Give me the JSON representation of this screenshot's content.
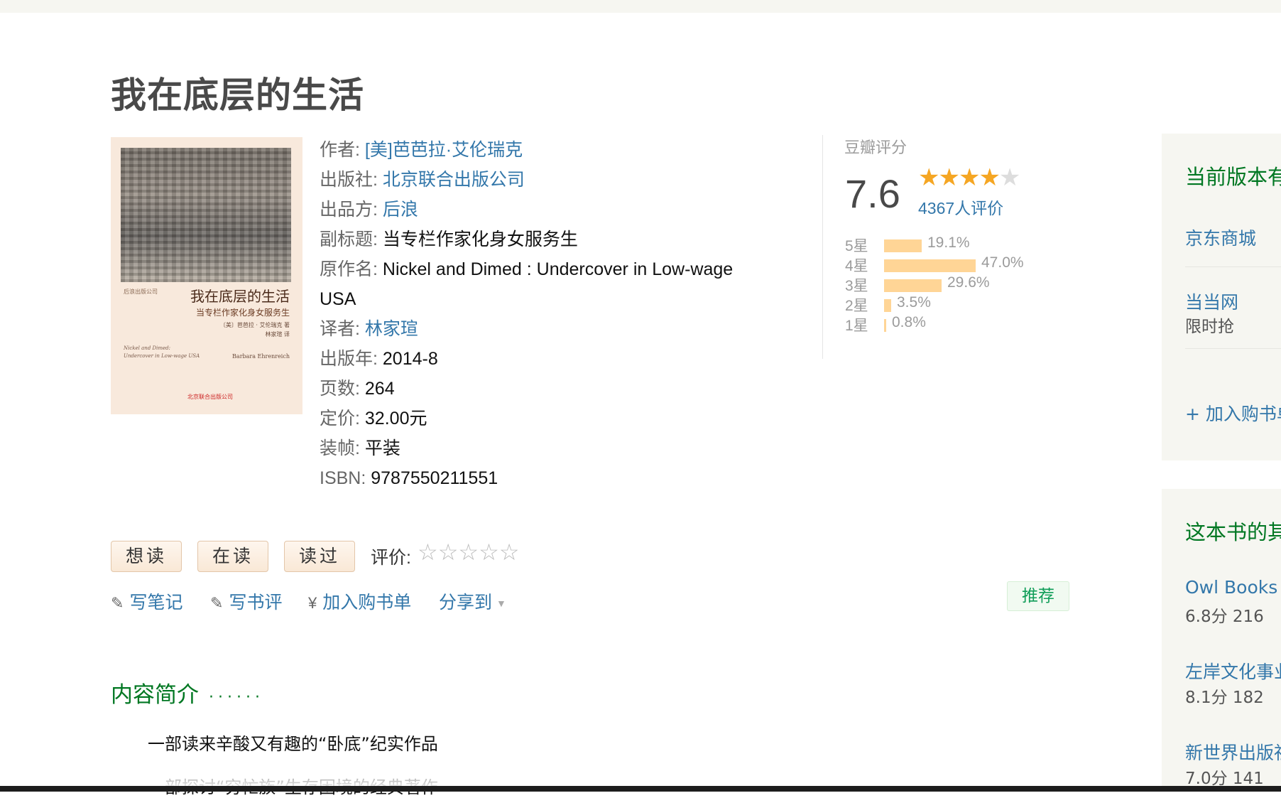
{
  "title": "我在底层的生活",
  "cover": {
    "publisher_tiny": "后浪出版公司",
    "title": "我在底层的生活",
    "subtitle": "当专栏作家化身女服务生",
    "authors_cn_1": "〔美〕芭芭拉 · 艾伦瑞克  著",
    "authors_cn_2": "林家瑄  译",
    "english_title_1": "Nickel and Dimed:",
    "english_title_2": "Undercover in Low-wage USA",
    "author_en": "Barbara Ehrenreich",
    "press_logo": "北京联合出版公司"
  },
  "info": {
    "author_label": "作者:",
    "author": "[美]芭芭拉·艾伦瑞克",
    "publisher_label": "出版社:",
    "publisher": "北京联合出版公司",
    "producer_label": "出品方:",
    "producer": "后浪",
    "subtitle_label": "副标题:",
    "subtitle": "当专栏作家化身女服务生",
    "original_label": "原作名:",
    "original": "Nickel and Dimed : Undercover in Low-wage USA",
    "translator_label": "译者:",
    "translator": "林家瑄",
    "year_label": "出版年:",
    "year": "2014-8",
    "pages_label": "页数:",
    "pages": "264",
    "price_label": "定价:",
    "price": "32.00元",
    "binding_label": "装帧:",
    "binding": "平装",
    "isbn_label": "ISBN:",
    "isbn": "9787550211551"
  },
  "rating": {
    "label": "豆瓣评分",
    "score": "7.6",
    "stars_filled": "★★★★",
    "stars_empty": "★",
    "count": "4367人评价",
    "distribution": [
      {
        "label": "5星",
        "pct": "19.1%",
        "value": 19.1
      },
      {
        "label": "4星",
        "pct": "47.0%",
        "value": 47.0
      },
      {
        "label": "3星",
        "pct": "29.6%",
        "value": 29.6
      },
      {
        "label": "2星",
        "pct": "3.5%",
        "value": 3.5
      },
      {
        "label": "1星",
        "pct": "0.8%",
        "value": 0.8
      }
    ]
  },
  "actions": {
    "want": "想读",
    "reading": "在读",
    "read": "读过",
    "rate_label": "评价:",
    "rate_stars": "☆☆☆☆☆"
  },
  "tools": {
    "note_icon": "✎",
    "note": "写笔记",
    "review_icon": "✎",
    "review": "写书评",
    "cart_icon": "¥",
    "cart": "加入购书单",
    "share": "分享到",
    "share_caret": "▼",
    "recommend": "推荐"
  },
  "intro": {
    "heading": "内容简介",
    "dots": "······",
    "p1": "一部读来辛酸又有趣的“卧底”纪实作品",
    "p2": "一部探讨“穷忙族”生存困境的经典著作"
  },
  "sidebar": {
    "h1": "当前版本有",
    "jd": "京东商城",
    "dangdang": "当当网",
    "dangdang_sub": "限时抢",
    "add_cart": "+ 加入购书单",
    "h2": "这本书的其",
    "editions": [
      {
        "name": "Owl Books (",
        "meta": "6.8分    216"
      },
      {
        "name": "左岸文化事业",
        "meta": "8.1分    182"
      },
      {
        "name": "新世界出版社",
        "meta": "7.0分    141"
      }
    ]
  }
}
